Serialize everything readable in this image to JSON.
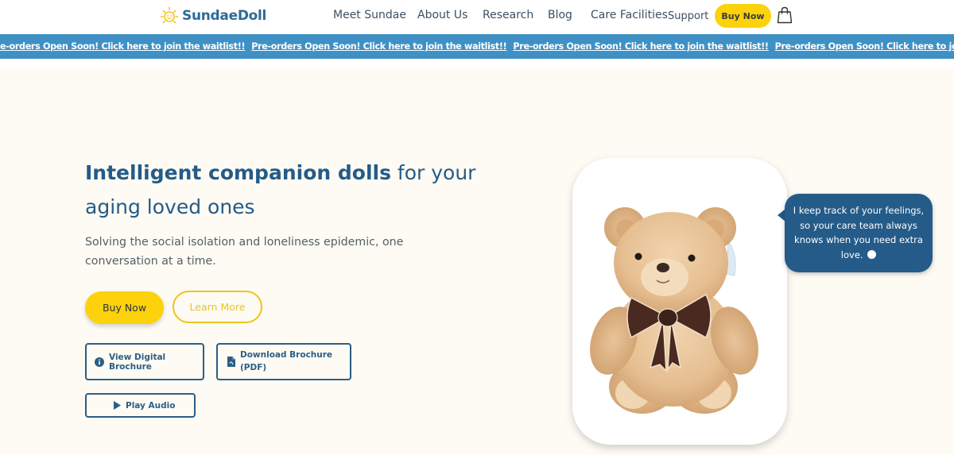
{
  "brand": {
    "name": "SundaeDoll",
    "logo_icon": "sun-icon"
  },
  "nav": {
    "items": [
      "Meet Sundae",
      "About Us",
      "Research",
      "Blog",
      "Care Facilities",
      "Support"
    ],
    "buy_label": "Buy Now",
    "cart_icon": "shopping-bag-icon"
  },
  "ticker": {
    "message": "Pre-orders Open Soon! Click here to join the waitlist!!",
    "first_partial": "e-orders Open Soon! Click here to join the waitlist!!",
    "background": "#3f91c5"
  },
  "hero": {
    "headline_bold": "Intelligent companion dolls",
    "headline_rest": " for your aging loved ones",
    "subtext": "Solving the social isolation and loneliness epidemic, one conversation at a time.",
    "buy_label": "Buy Now",
    "learn_label": "Learn More",
    "view_brochure_label": "View Digital Brochure",
    "download_brochure_label": "Download Brochure (PDF)",
    "play_audio_label": "Play Audio"
  },
  "bubble": {
    "text": "I keep track of your feelings, so your care team always knows when you need extra love."
  },
  "colors": {
    "accent_yellow": "#fbd20b",
    "primary_blue": "#245b89",
    "page_background": "#fdfbf3"
  }
}
